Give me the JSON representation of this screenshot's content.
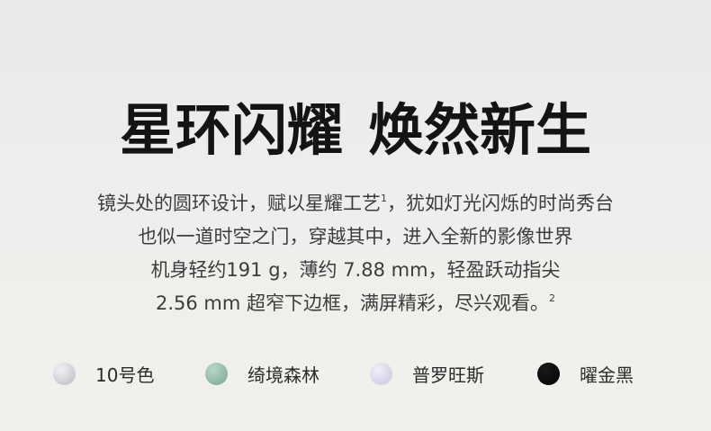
{
  "headline": {
    "part1": "星环闪耀",
    "part2": "焕然新生"
  },
  "description": {
    "line1_a": "镜头处的圆环设计，赋以星耀工艺",
    "line1_sup": "1",
    "line1_b": "，犹如灯光闪烁的时尚秀台",
    "line2": "也似一道时空之门，穿越其中，进入全新的影像世界",
    "line3": "机身轻约191 g，薄约 7.88 mm，轻盈跃动指尖",
    "line4": "2.56 mm 超窄下边框，满屏精彩，尽兴观看。",
    "line4_sup": "2"
  },
  "colors": [
    {
      "label": "10号色",
      "gradient_from": "#f2f2f5",
      "gradient_to": "#b9bac2"
    },
    {
      "label": "绮境森林",
      "gradient_from": "#b7d8c8",
      "gradient_to": "#7aa593"
    },
    {
      "label": "普罗旺斯",
      "gradient_from": "#f1f0fa",
      "gradient_to": "#c6c5de"
    },
    {
      "label": "曜金黑",
      "gradient_from": "#1a1a1a",
      "gradient_to": "#000000"
    }
  ]
}
